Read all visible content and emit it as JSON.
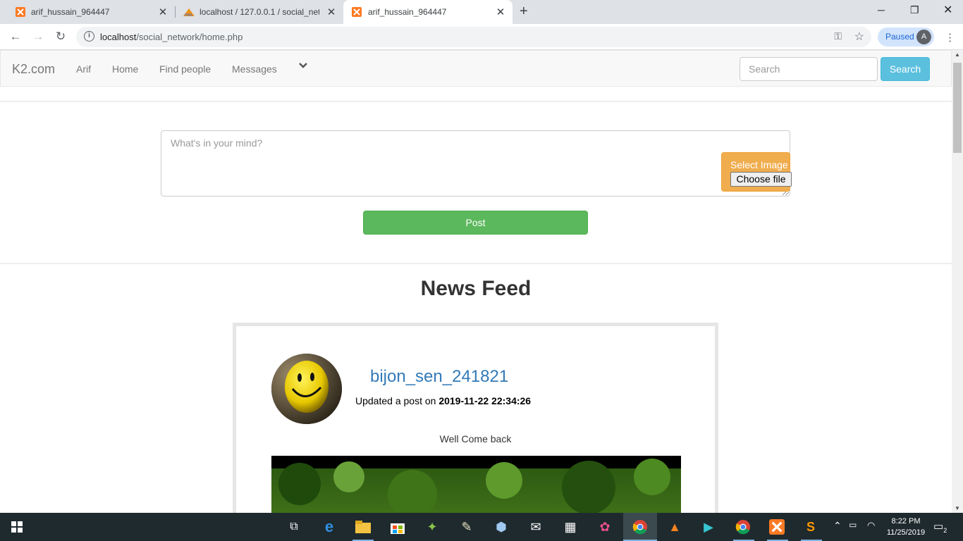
{
  "browser": {
    "tabs": [
      {
        "title": "arif_hussain_964447"
      },
      {
        "title": "localhost / 127.0.0.1 / social_netw"
      },
      {
        "title": "arif_hussain_964447"
      }
    ],
    "url_host": "localhost",
    "url_path": "/social_network/home.php",
    "profile_status": "Paused",
    "profile_initial": "A"
  },
  "site": {
    "brand": "K2.com",
    "nav": [
      "Arif",
      "Home",
      "Find people",
      "Messages"
    ],
    "search_placeholder": "Search",
    "search_button": "Search"
  },
  "composer": {
    "placeholder": "What's in your mind?",
    "select_image_label": "Select Image",
    "choose_file_label": "Choose file",
    "post_button": "Post"
  },
  "feed": {
    "title": "News Feed",
    "posts": [
      {
        "username": "bijon_sen_241821",
        "updated_prefix": "Updated a post on",
        "timestamp": "2019-11-22 22:34:26",
        "content": "Well Come back"
      }
    ]
  },
  "taskbar": {
    "time": "8:22 PM",
    "date": "11/25/2019",
    "notification_count": "2"
  },
  "colors": {
    "search_button": "#5bc0de",
    "select_image": "#f0ad4e",
    "post_button": "#5cb85c",
    "username_link": "#337ab7"
  }
}
